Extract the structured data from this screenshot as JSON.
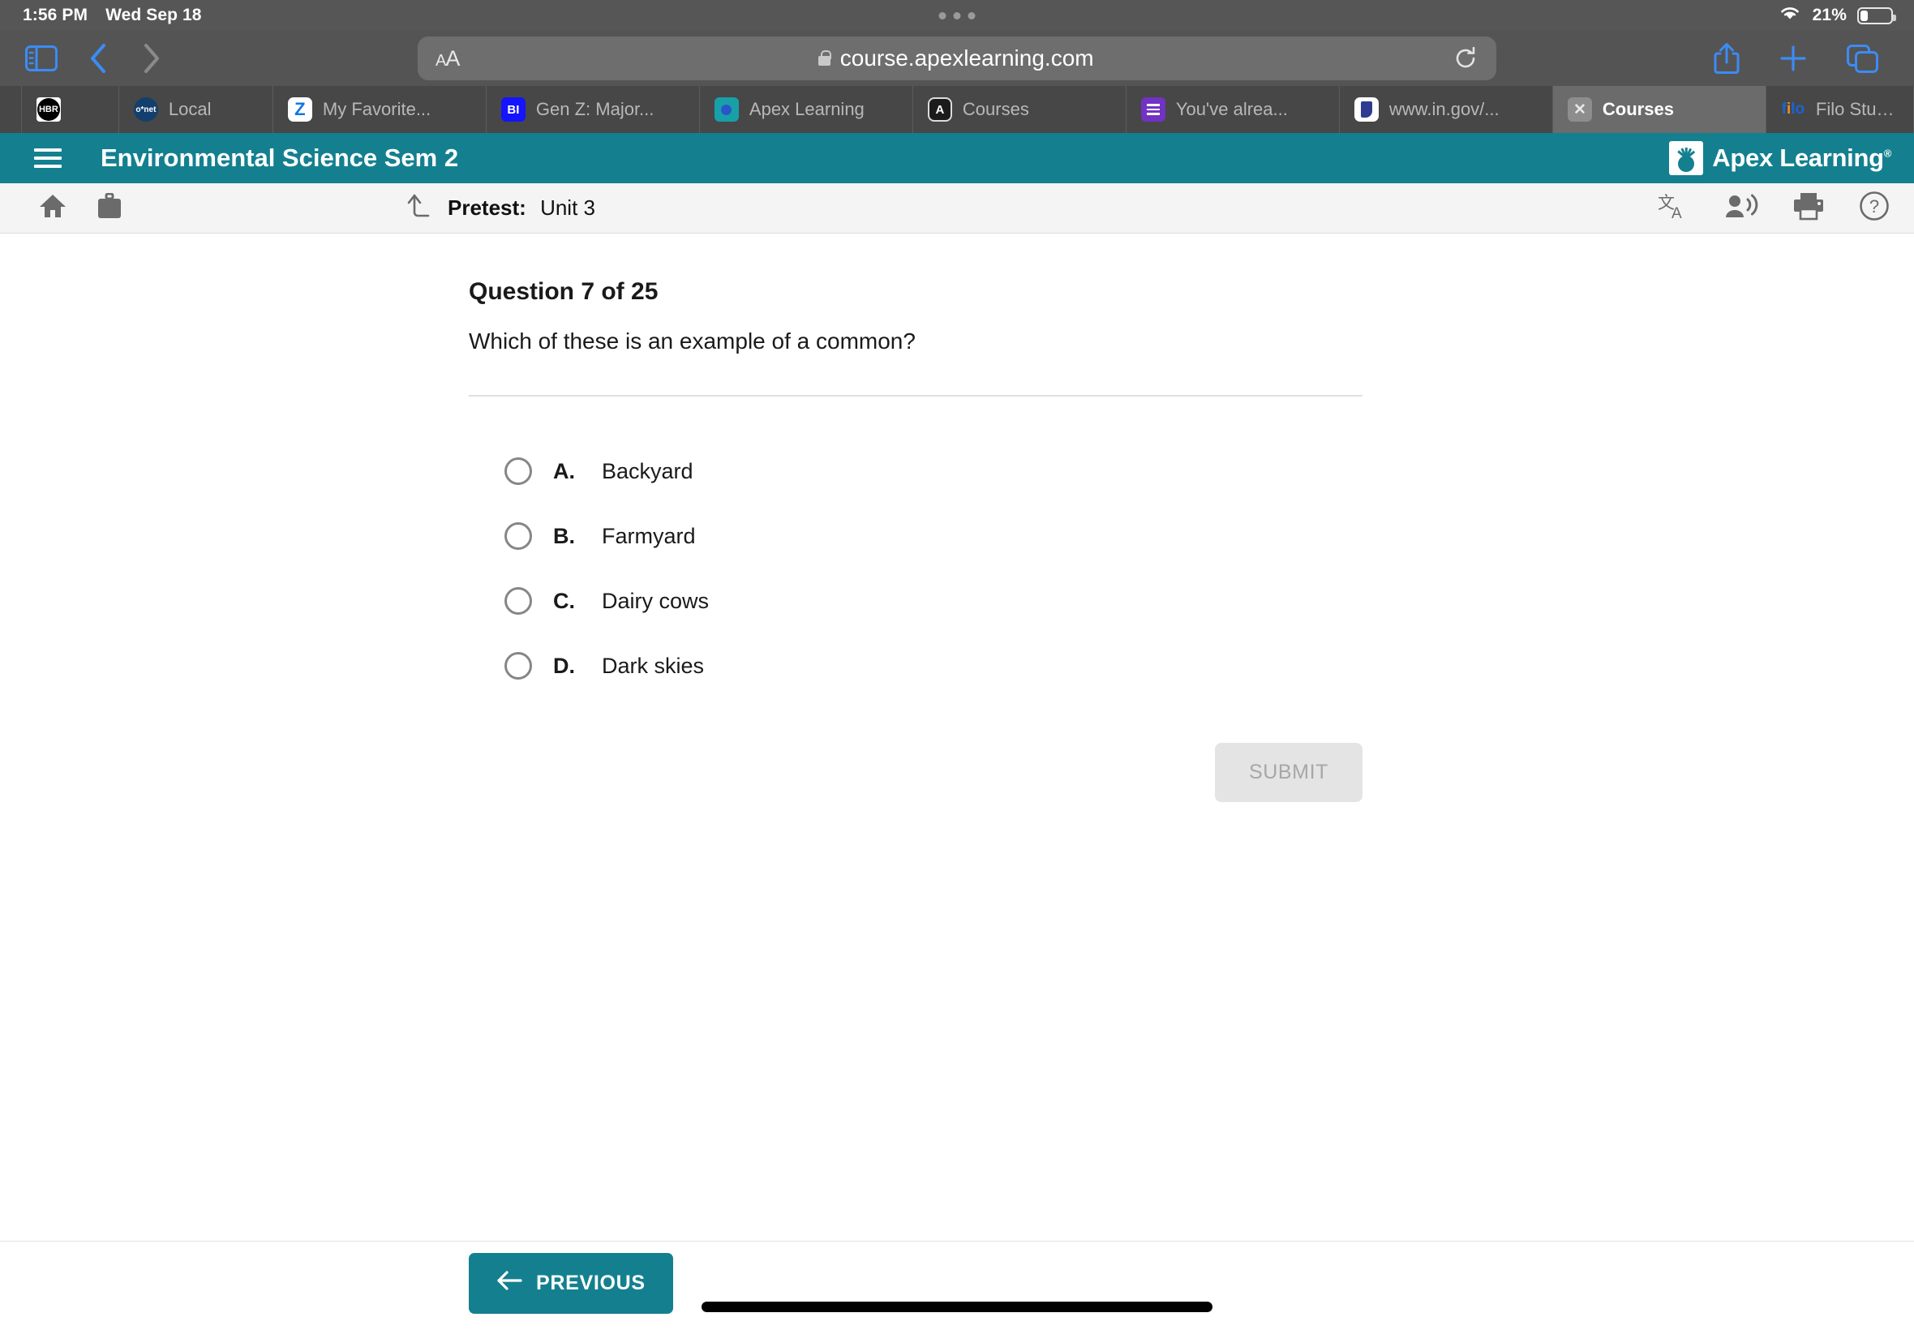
{
  "status_bar": {
    "time": "1:56 PM",
    "date": "Wed Sep 18",
    "battery_percent": "21%",
    "wifi_icon": "wifi-icon",
    "battery_icon": "battery-icon"
  },
  "browser": {
    "sidebar_icon": "sidebar-icon",
    "back_icon": "back-chevron-icon",
    "forward_icon": "forward-chevron-icon",
    "text_size_label": "AA",
    "url": "course.apexlearning.com",
    "lock_icon": "lock-icon",
    "reload_icon": "reload-icon",
    "share_icon": "share-icon",
    "new_tab_icon": "plus-icon",
    "tabs_overview_icon": "tabs-overview-icon",
    "tabs": [
      {
        "label": "",
        "favicon": "hbr-icon",
        "active": false
      },
      {
        "label": "Local",
        "favicon": "onet-icon",
        "active": false
      },
      {
        "label": "My Favorite...",
        "favicon": "zillow-icon",
        "active": false
      },
      {
        "label": "Gen Z: Major...",
        "favicon": "business-insider-icon",
        "active": false
      },
      {
        "label": "Apex Learning",
        "favicon": "apex-learning-icon",
        "active": false
      },
      {
        "label": "Courses",
        "favicon": "apex-a-icon",
        "active": false
      },
      {
        "label": "You've alrea...",
        "favicon": "list-icon",
        "active": false
      },
      {
        "label": "www.in.gov/...",
        "favicon": "indiana-gov-icon",
        "active": false
      },
      {
        "label": "Courses",
        "favicon": "close-icon",
        "active": true
      },
      {
        "label": "Filo Student:...",
        "favicon": "filo-icon",
        "active": false
      }
    ]
  },
  "apex_header": {
    "menu_icon": "hamburger-menu-icon",
    "course_title": "Environmental Science Sem 2",
    "logo_text": "Apex Learning",
    "logo_trademark": "®"
  },
  "lesson_bar": {
    "home_icon": "home-icon",
    "briefcase_icon": "briefcase-icon",
    "back_to_lesson_icon": "arrow-up-left-icon",
    "activity_type": "Pretest:",
    "activity_name": "Unit 3",
    "translate_icon": "translate-icon",
    "read_aloud_icon": "read-aloud-icon",
    "print_icon": "print-icon",
    "help_icon": "help-icon"
  },
  "question": {
    "heading": "Question 7 of 25",
    "prompt": "Which of these is an example of a common?",
    "options": [
      {
        "letter": "A.",
        "text": "Backyard",
        "selected": false
      },
      {
        "letter": "B.",
        "text": "Farmyard",
        "selected": false
      },
      {
        "letter": "C.",
        "text": "Dairy cows",
        "selected": false
      },
      {
        "letter": "D.",
        "text": "Dark skies",
        "selected": false
      }
    ],
    "submit_label": "SUBMIT",
    "submit_enabled": false
  },
  "footer": {
    "previous_label": "PREVIOUS",
    "previous_arrow_icon": "arrow-left-icon"
  },
  "colors": {
    "brand_teal": "#14808f",
    "safari_chrome": "#545454",
    "accent_blue": "#3b8cf5"
  }
}
